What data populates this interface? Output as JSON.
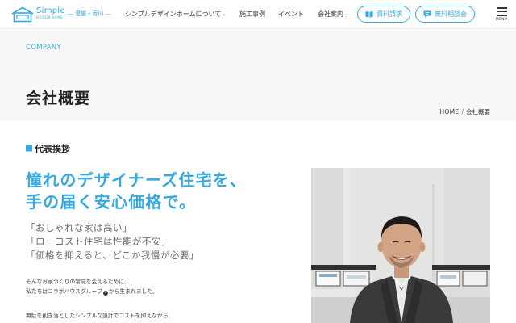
{
  "header": {
    "logo_text": "Simple",
    "logo_sub": "DESIGN HOME",
    "region": "— 愛媛・香川 —",
    "nav": [
      {
        "label": "シンプルデザインホームについて",
        "has_dropdown": true
      },
      {
        "label": "施工事例",
        "has_dropdown": false
      },
      {
        "label": "イベント",
        "has_dropdown": false
      },
      {
        "label": "会社案内",
        "has_dropdown": true
      }
    ],
    "buttons": [
      {
        "label": "資料請求",
        "icon": "book-icon"
      },
      {
        "label": "無料相談会",
        "icon": "chat-icon"
      }
    ],
    "menu_label": "MENU",
    "accent_color": "#35a9e0"
  },
  "title_area": {
    "eyebrow": "COMPANY",
    "title": "会社概要",
    "breadcrumb": {
      "home": "HOME",
      "separator": "/",
      "current": "会社概要"
    }
  },
  "content": {
    "section_heading": "代表挨拶",
    "catch_lines": [
      "憧れのデザイナーズ住宅を、",
      "手の届く安心価格で。"
    ],
    "quotes": [
      "「おしゃれな家は高い」",
      "「ローコスト住宅は性能が不安」",
      "「価格を抑えると、どこか我慢が必要」"
    ],
    "body_line1": "そんなお家づくりの常識を変えるために、",
    "body_line2_before": "私たちはコラボハウスグループ",
    "body_line2_icon": "?",
    "body_line2_after": "から生まれました。",
    "body_line3": "無駄を削ぎ落としたシンプルな設計でコストを抑えながら、"
  },
  "photo": {
    "subject": "portrait-photo"
  }
}
